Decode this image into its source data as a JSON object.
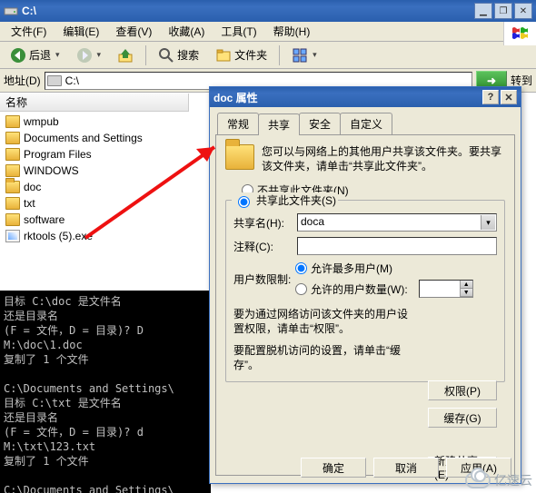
{
  "window": {
    "title": "C:\\"
  },
  "menu": {
    "file": "文件(F)",
    "edit": "编辑(E)",
    "view": "查看(V)",
    "favorites": "收藏(A)",
    "tools": "工具(T)",
    "help": "帮助(H)"
  },
  "toolbar": {
    "back": "后退",
    "search": "搜索",
    "folders": "文件夹"
  },
  "address": {
    "label": "地址(D)",
    "path": "C:\\",
    "go": "转到"
  },
  "files": {
    "column": "名称",
    "items": [
      {
        "name": "wmpub",
        "type": "folder"
      },
      {
        "name": "Documents and Settings",
        "type": "folder"
      },
      {
        "name": "Program Files",
        "type": "folder"
      },
      {
        "name": "WINDOWS",
        "type": "folder"
      },
      {
        "name": "doc",
        "type": "folder-open"
      },
      {
        "name": "txt",
        "type": "folder"
      },
      {
        "name": "software",
        "type": "folder"
      },
      {
        "name": "rktools (5).exe",
        "type": "exe"
      }
    ]
  },
  "console": {
    "lines": [
      "目标 C:\\doc 是文件名",
      "还是目录名",
      "(F = 文件，D = 目录)? D",
      "M:\\doc\\1.doc",
      "复制了 1 个文件",
      "",
      "C:\\Documents and Settings\\",
      "目标 C:\\txt 是文件名",
      "还是目录名",
      "(F = 文件，D = 目录)? d",
      "M:\\txt\\123.txt",
      "复制了 1 个文件",
      "",
      "C:\\Documents and Settings\\"
    ]
  },
  "dialog": {
    "title": "doc 属性",
    "tabs": {
      "general": "常规",
      "sharing": "共享",
      "security": "安全",
      "custom": "自定义"
    },
    "info": "您可以与网络上的其他用户共享该文件夹。要共享该文件夹，请单击“共享此文件夹”。",
    "radio_noshare": "不共享此文件夹(N)",
    "radio_share": "共享此文件夹(S)",
    "sharename_label": "共享名(H):",
    "sharename_value": "doca",
    "comment_label": "注释(C):",
    "comment_value": "",
    "limit_label": "用户数限制:",
    "limit_max": "允许最多用户(M)",
    "limit_n": "允许的用户数量(W):",
    "perm_text": "要为通过网络访问该文件夹的用户设置权限，请单击“权限”。",
    "perm_btn": "权限(P)",
    "cache_text": "要配置脱机访问的设置，请单击“缓存”。",
    "cache_btn": "缓存(G)",
    "newshare_btn": "新建共享(E)",
    "ok": "确定",
    "cancel": "取消",
    "apply": "应用(A)"
  },
  "watermark": "亿速云"
}
